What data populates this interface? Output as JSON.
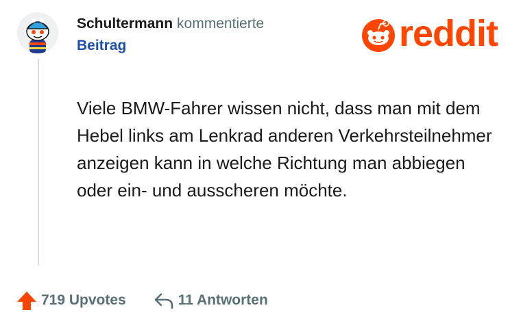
{
  "header": {
    "author": "Schultermann",
    "action": "kommentierte",
    "post_label": "Beitrag"
  },
  "logo": {
    "wordmark": "reddit",
    "icon": "reddit-snoo-icon",
    "color": "#ff4500"
  },
  "comment": {
    "text": "Viele BMW-Fahrer wissen nicht, dass man mit dem Hebel links am Lenkrad anderen Verkehrsteilnehmer anzeigen kann in welche Richtung man abbiegen oder ein- und ausscheren möchte."
  },
  "footer": {
    "upvotes": "719 Upvotes",
    "replies": "11 Antworten",
    "upvote_icon": "upvote-arrow-icon",
    "reply_icon": "reply-arrow-icon"
  },
  "colors": {
    "accent": "#ff4500",
    "link": "#1d4fae",
    "muted": "#576f76",
    "text": "#1a1a1b"
  }
}
